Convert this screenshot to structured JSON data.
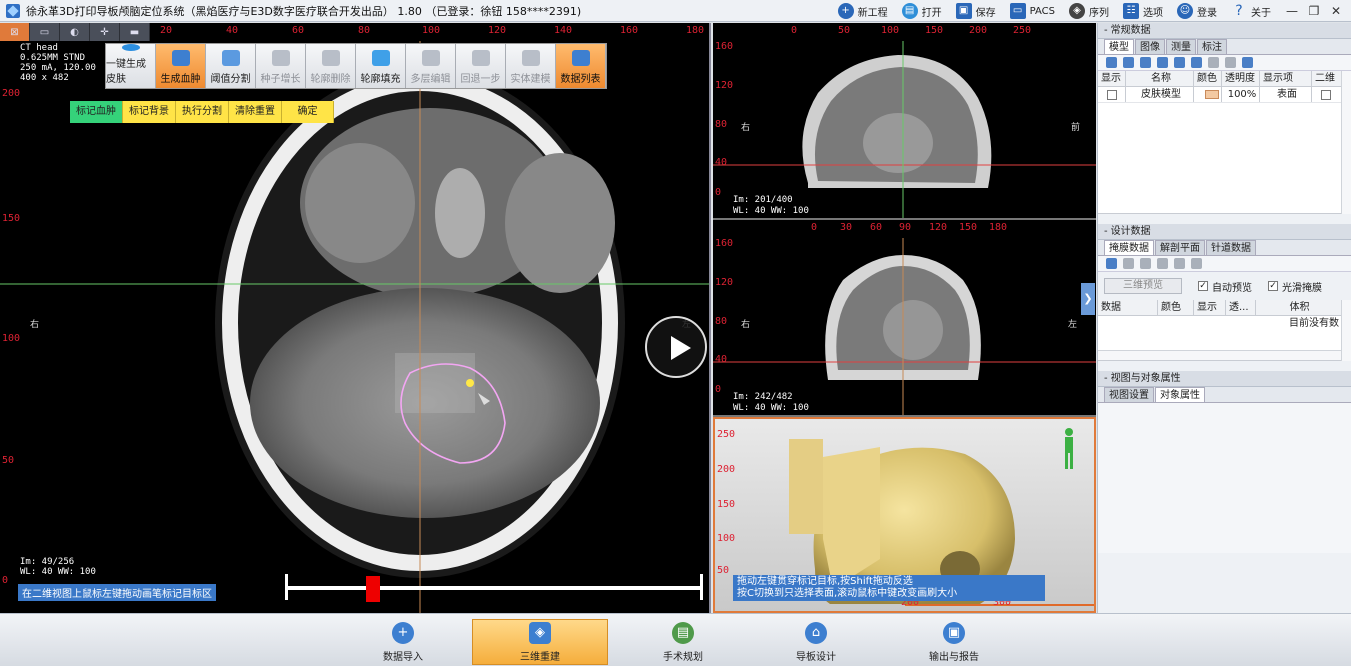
{
  "titlebar": {
    "title": "徐永革3D打印导板颅脑定位系统（黑焰医疗与E3D数字医疗联合开发出品） 1.80 （已登录：徐钮 158****2391)",
    "menu": [
      {
        "icon": "plus-circle-icon",
        "label": "新工程"
      },
      {
        "icon": "folder-open-icon",
        "label": "打开"
      },
      {
        "icon": "save-disk-icon",
        "label": "保存"
      },
      {
        "icon": "monitor-icon",
        "label": "PACS"
      },
      {
        "icon": "layers-icon",
        "label": "序列"
      },
      {
        "icon": "options-icon",
        "label": "选项"
      },
      {
        "icon": "user-icon",
        "label": "登录"
      },
      {
        "icon": "help-icon",
        "label": "关于"
      }
    ],
    "window_buttons": [
      "—",
      "❐",
      "✕"
    ]
  },
  "left_view": {
    "tabs": [
      "⊠",
      "▭",
      "◐",
      "✛",
      "▬"
    ],
    "ruler_top": [
      "20",
      "40",
      "60",
      "80",
      "100",
      "120",
      "140",
      "160",
      "180"
    ],
    "ruler_left": [
      "200",
      "150",
      "100",
      "50",
      "0"
    ],
    "info": [
      "CT head",
      "0.625MM STND",
      "250 mA, 120.00",
      "400 x 482"
    ],
    "tools": [
      {
        "label": "一键生成皮肤",
        "icon": "auto-skin-icon",
        "state": "normal"
      },
      {
        "label": "生成血肿",
        "icon": "hematoma-icon",
        "state": "orange"
      },
      {
        "label": "阈值分割",
        "icon": "threshold-icon",
        "state": "normal"
      },
      {
        "label": "种子增长",
        "icon": "seed-grow-icon",
        "state": "disabled"
      },
      {
        "label": "轮廓删除",
        "icon": "contour-delete-icon",
        "state": "disabled"
      },
      {
        "label": "轮廓填充",
        "icon": "contour-fill-icon",
        "state": "normal"
      },
      {
        "label": "多层编辑",
        "icon": "multi-layer-icon",
        "state": "disabled"
      },
      {
        "label": "回退一步",
        "icon": "undo-icon",
        "state": "disabled"
      },
      {
        "label": "实体建模",
        "icon": "solid-model-icon",
        "state": "disabled"
      },
      {
        "label": "数据列表",
        "icon": "data-list-icon",
        "state": "orange"
      }
    ],
    "sub_tools": [
      "标记血肿",
      "标记背景",
      "执行分割",
      "清除重置",
      "确定"
    ],
    "left_side_label": "右",
    "right_side_label": "左",
    "status": [
      "Im: 49/256",
      "WL: 40  WW: 100"
    ],
    "hint": "在二维视图上鼠标左键拖动画笔标记目标区",
    "slider_position": 0.2
  },
  "sagittal": {
    "ruler_top": [
      "0",
      "50",
      "100",
      "150",
      "200",
      "250"
    ],
    "ruler_left": [
      "160",
      "120",
      "80",
      "40",
      "0"
    ],
    "left_label": "右",
    "right_label": "前",
    "info": [
      "Im: 201/400",
      "WL: 40  WW: 100"
    ]
  },
  "coronal": {
    "ruler_top": [
      "0",
      "30",
      "60",
      "90",
      "120",
      "150",
      "180"
    ],
    "ruler_left": [
      "160",
      "120",
      "80",
      "40",
      "0"
    ],
    "left_label": "右",
    "right_label": "左",
    "info": [
      "Im: 242/482",
      "WL: 40  WW: 100"
    ]
  },
  "view3d": {
    "ruler_left": [
      "250",
      "200",
      "150",
      "100",
      "50"
    ],
    "ruler_bottom": [
      "200",
      "300"
    ],
    "hint_lines": [
      "拖动左键贯穿标记目标,按Shift拖动反选",
      "按C切换到只选择表面,滚动鼠标中键改变画刷大小"
    ]
  },
  "right_panel": {
    "section1": "常规数据",
    "tabs1": [
      "模型",
      "图像",
      "测量",
      "标注"
    ],
    "model_columns": [
      "显示",
      "名称",
      "颜色",
      "透明度",
      "显示项",
      "二维"
    ],
    "model_rows": [
      {
        "name": "皮肤模型",
        "color": "#f3c9a2",
        "opacity": "100%",
        "display": "表面"
      }
    ],
    "section2": "设计数据",
    "tabs2": [
      "掩膜数据",
      "解剖平面",
      "针道数据"
    ],
    "preview_button": "三维预览",
    "auto_preview": "自动预览",
    "smooth_mask": "光滑掩膜",
    "mask_columns": [
      "数据",
      "颜色",
      "显示",
      "透...",
      "体积"
    ],
    "mask_empty": "目前没有数",
    "section3": "视图与对象属性",
    "tabs3": [
      "视图设置",
      "对象属性"
    ]
  },
  "bottom_nav": [
    {
      "label": "数据导入",
      "icon": "import-icon",
      "active": false
    },
    {
      "label": "三维重建",
      "icon": "reconstruct-icon",
      "active": true
    },
    {
      "label": "手术规划",
      "icon": "surgery-plan-icon",
      "active": false
    },
    {
      "label": "导板设计",
      "icon": "guide-design-icon",
      "active": false
    },
    {
      "label": "输出与报告",
      "icon": "report-icon",
      "active": false
    }
  ]
}
